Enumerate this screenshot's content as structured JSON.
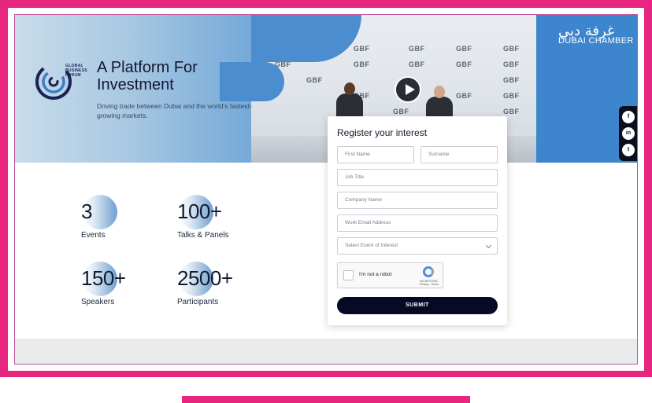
{
  "hero": {
    "logo": {
      "line1": "GLOBAL",
      "line2": "BUSINESS",
      "line3": "FORUM"
    },
    "title": "A Platform For Investment",
    "subtitle": "Driving trade between Dubai and the world's fastest-growing markets.",
    "wall_logo": "GBF",
    "chamber": {
      "arabic": "غرفة دبي",
      "name": "DUBAI CHAMBER"
    }
  },
  "social": [
    {
      "label": "f",
      "icon": "facebook-icon"
    },
    {
      "label": "in",
      "icon": "linkedin-icon"
    },
    {
      "label": "t",
      "icon": "twitter-icon"
    }
  ],
  "stats": [
    {
      "number": "3",
      "label": "Events"
    },
    {
      "number": "100+",
      "label": "Talks & Panels"
    },
    {
      "number": "150+",
      "label": "Speakers"
    },
    {
      "number": "2500+",
      "label": "Participants"
    }
  ],
  "form": {
    "title": "Register your interest",
    "first_name_placeholder": "First Name",
    "surname_placeholder": "Surname",
    "job_title_placeholder": "Job Title",
    "company_placeholder": "Company Name",
    "email_placeholder": "Work Email Address",
    "event_select": "Select Event of Interest",
    "captcha_label": "I'm not a robot",
    "captcha_brand": "reCAPTCHA",
    "captcha_terms": "Privacy - Terms",
    "submit_label": "SUBMIT"
  },
  "colors": {
    "accent": "#e8257f",
    "navy": "#070a24",
    "hero_blue": "#3f86cc"
  }
}
